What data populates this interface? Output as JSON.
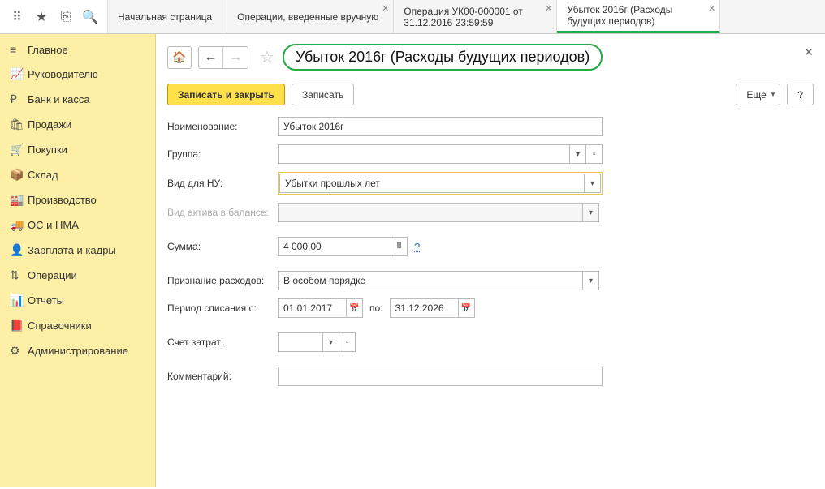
{
  "toolbar": {
    "tabs": [
      {
        "label": "Начальная страница"
      },
      {
        "label": "Операции, введенные вручную"
      },
      {
        "label": "Операция УК00-000001 от 31.12.2016 23:59:59"
      },
      {
        "label": "Убыток 2016г (Расходы будущих периодов)"
      }
    ]
  },
  "sidebar": {
    "items": [
      {
        "icon": "≡",
        "label": "Главное"
      },
      {
        "icon": "📈",
        "label": "Руководителю"
      },
      {
        "icon": "₽",
        "label": "Банк и касса"
      },
      {
        "icon": "🛍",
        "label": "Продажи"
      },
      {
        "icon": "🛒",
        "label": "Покупки"
      },
      {
        "icon": "📦",
        "label": "Склад"
      },
      {
        "icon": "🏭",
        "label": "Производство"
      },
      {
        "icon": "🚚",
        "label": "ОС и НМА"
      },
      {
        "icon": "👤",
        "label": "Зарплата и кадры"
      },
      {
        "icon": "⇅",
        "label": "Операции"
      },
      {
        "icon": "📊",
        "label": "Отчеты"
      },
      {
        "icon": "📕",
        "label": "Справочники"
      },
      {
        "icon": "⚙",
        "label": "Администрирование"
      }
    ]
  },
  "main": {
    "title": "Убыток 2016г (Расходы будущих периодов)",
    "buttons": {
      "save_close": "Записать и закрыть",
      "save": "Записать",
      "more": "Еще",
      "help": "?"
    },
    "form": {
      "name_label": "Наименование:",
      "name_value": "Убыток 2016г",
      "group_label": "Группа:",
      "group_value": "",
      "vidnu_label": "Вид для НУ:",
      "vidnu_value": "Убытки прошлых лет",
      "asset_label": "Вид актива в балансе:",
      "asset_value": "",
      "sum_label": "Сумма:",
      "sum_value": "4 000,00",
      "rec_label": "Признание расходов:",
      "rec_value": "В особом порядке",
      "period_label": "Период списания с:",
      "period_from": "01.01.2017",
      "period_to_label": "по:",
      "period_to": "31.12.2026",
      "acct_label": "Счет затрат:",
      "acct_value": "",
      "comment_label": "Комментарий:",
      "comment_value": "",
      "q": "?"
    }
  }
}
